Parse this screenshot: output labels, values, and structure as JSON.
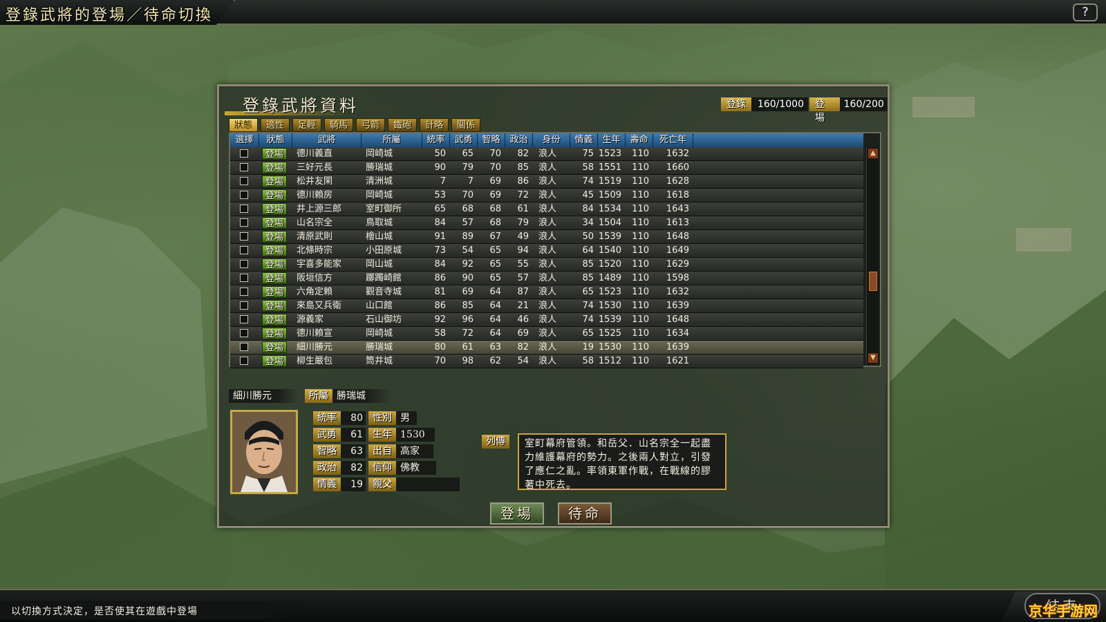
{
  "window_title": "登錄武將的登場／待命切換",
  "help_label": "?",
  "panel": {
    "title": "登錄武將資料",
    "registered_label": "登錄",
    "registered_value": "160/1000",
    "appeared_label": "登場",
    "appeared_value": "160/200",
    "tabs": [
      "狀態",
      "適性",
      "足輕",
      "騎馬",
      "弓箭",
      "鐵砲",
      "計略",
      "關係"
    ],
    "active_tab": 0,
    "columns": [
      "選擇",
      "狀態",
      "武將",
      "所屬",
      "統率",
      "武勇",
      "智略",
      "政治",
      "身份",
      "情義",
      "生年",
      "壽命",
      "死亡年"
    ],
    "rows": [
      {
        "status": "登場",
        "name": "德川義直",
        "affiliation": "岡崎城",
        "leadership": "50",
        "valor": "65",
        "intellect": "70",
        "politics": "82",
        "rank": "浪人",
        "loyalty": "75",
        "birth": "1523",
        "lifespan": "110",
        "death": "1632"
      },
      {
        "status": "登場",
        "name": "三好元長",
        "affiliation": "勝瑞城",
        "leadership": "90",
        "valor": "79",
        "intellect": "70",
        "politics": "85",
        "rank": "浪人",
        "loyalty": "58",
        "birth": "1551",
        "lifespan": "110",
        "death": "1660"
      },
      {
        "status": "登場",
        "name": "松井友閑",
        "affiliation": "清洲城",
        "leadership": "7",
        "valor": "7",
        "intellect": "69",
        "politics": "86",
        "rank": "浪人",
        "loyalty": "74",
        "birth": "1519",
        "lifespan": "110",
        "death": "1628"
      },
      {
        "status": "登場",
        "name": "德川賴房",
        "affiliation": "岡崎城",
        "leadership": "53",
        "valor": "70",
        "intellect": "69",
        "politics": "72",
        "rank": "浪人",
        "loyalty": "45",
        "birth": "1509",
        "lifespan": "110",
        "death": "1618"
      },
      {
        "status": "登場",
        "name": "井上源三郎",
        "affiliation": "室町御所",
        "leadership": "65",
        "valor": "68",
        "intellect": "68",
        "politics": "61",
        "rank": "浪人",
        "loyalty": "84",
        "birth": "1534",
        "lifespan": "110",
        "death": "1643"
      },
      {
        "status": "登場",
        "name": "山名宗全",
        "affiliation": "鳥取城",
        "leadership": "84",
        "valor": "57",
        "intellect": "68",
        "politics": "79",
        "rank": "浪人",
        "loyalty": "34",
        "birth": "1504",
        "lifespan": "110",
        "death": "1613"
      },
      {
        "status": "登場",
        "name": "清原武則",
        "affiliation": "檜山城",
        "leadership": "91",
        "valor": "89",
        "intellect": "67",
        "politics": "49",
        "rank": "浪人",
        "loyalty": "50",
        "birth": "1539",
        "lifespan": "110",
        "death": "1648"
      },
      {
        "status": "登場",
        "name": "北條時宗",
        "affiliation": "小田原城",
        "leadership": "73",
        "valor": "54",
        "intellect": "65",
        "politics": "94",
        "rank": "浪人",
        "loyalty": "64",
        "birth": "1540",
        "lifespan": "110",
        "death": "1649"
      },
      {
        "status": "登場",
        "name": "宇喜多能家",
        "affiliation": "岡山城",
        "leadership": "84",
        "valor": "92",
        "intellect": "65",
        "politics": "55",
        "rank": "浪人",
        "loyalty": "85",
        "birth": "1520",
        "lifespan": "110",
        "death": "1629"
      },
      {
        "status": "登場",
        "name": "阪垣信方",
        "affiliation": "躑躅崎館",
        "leadership": "86",
        "valor": "90",
        "intellect": "65",
        "politics": "57",
        "rank": "浪人",
        "loyalty": "85",
        "birth": "1489",
        "lifespan": "110",
        "death": "1598"
      },
      {
        "status": "登場",
        "name": "六角定賴",
        "affiliation": "觀音寺城",
        "leadership": "81",
        "valor": "69",
        "intellect": "64",
        "politics": "87",
        "rank": "浪人",
        "loyalty": "65",
        "birth": "1523",
        "lifespan": "110",
        "death": "1632"
      },
      {
        "status": "登場",
        "name": "來島又兵衛",
        "affiliation": "山口館",
        "leadership": "86",
        "valor": "85",
        "intellect": "64",
        "politics": "21",
        "rank": "浪人",
        "loyalty": "74",
        "birth": "1530",
        "lifespan": "110",
        "death": "1639"
      },
      {
        "status": "登場",
        "name": "源義家",
        "affiliation": "石山御坊",
        "leadership": "92",
        "valor": "96",
        "intellect": "64",
        "politics": "46",
        "rank": "浪人",
        "loyalty": "74",
        "birth": "1539",
        "lifespan": "110",
        "death": "1648"
      },
      {
        "status": "登場",
        "name": "德川賴宣",
        "affiliation": "岡崎城",
        "leadership": "58",
        "valor": "72",
        "intellect": "64",
        "politics": "69",
        "rank": "浪人",
        "loyalty": "65",
        "birth": "1525",
        "lifespan": "110",
        "death": "1634"
      },
      {
        "status": "登場",
        "name": "細川勝元",
        "affiliation": "勝瑞城",
        "leadership": "80",
        "valor": "61",
        "intellect": "63",
        "politics": "82",
        "rank": "浪人",
        "loyalty": "19",
        "birth": "1530",
        "lifespan": "110",
        "death": "1639"
      },
      {
        "status": "登場",
        "name": "柳生嚴包",
        "affiliation": "筒井城",
        "leadership": "70",
        "valor": "98",
        "intellect": "62",
        "politics": "54",
        "rank": "浪人",
        "loyalty": "58",
        "birth": "1512",
        "lifespan": "110",
        "death": "1621"
      }
    ],
    "selected_row": 14
  },
  "detail": {
    "name": "細川勝元",
    "affiliation_label": "所屬",
    "affiliation": "勝瑞城",
    "stats": [
      {
        "label": "統率",
        "value": "80"
      },
      {
        "label": "武勇",
        "value": "61"
      },
      {
        "label": "智略",
        "value": "63"
      },
      {
        "label": "政治",
        "value": "82"
      },
      {
        "label": "情義",
        "value": "19"
      }
    ],
    "info": [
      {
        "label": "性別",
        "value": "男"
      },
      {
        "label": "生年",
        "value": "1530"
      },
      {
        "label": "出自",
        "value": "高家"
      },
      {
        "label": "信仰",
        "value": "佛教"
      },
      {
        "label": "親父",
        "value": ""
      }
    ],
    "bio_label": "列傳",
    "bio": "室町幕府管領。和岳父．山名宗全一起盡力維護幕府的勢力。之後兩人對立，引發了應仁之亂。率領東軍作戰，在戰線的膠著中死去。"
  },
  "buttons": {
    "appear": "登場",
    "standby": "待命"
  },
  "footer": {
    "hint": "以切換方式決定，是否使其在遊戲中登場",
    "end_label": "結束",
    "watermark": "京华手游网"
  }
}
